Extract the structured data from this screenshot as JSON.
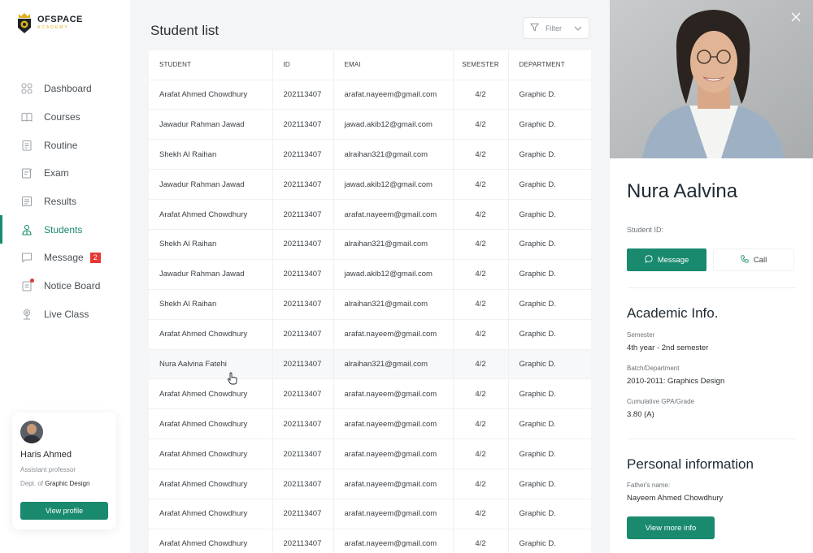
{
  "brand": {
    "name": "OFSPACE",
    "sub": "ACADEMY"
  },
  "nav": [
    {
      "label": "Dashboard",
      "icon": "dashboard-icon"
    },
    {
      "label": "Courses",
      "icon": "book-icon"
    },
    {
      "label": "Routine",
      "icon": "routine-icon"
    },
    {
      "label": "Exam",
      "icon": "exam-icon"
    },
    {
      "label": "Results",
      "icon": "results-icon"
    },
    {
      "label": "Students",
      "icon": "students-icon",
      "active": true
    },
    {
      "label": "Message",
      "icon": "message-icon",
      "badge": "2"
    },
    {
      "label": "Notice Board",
      "icon": "notice-icon",
      "dot": true
    },
    {
      "label": "Live Class",
      "icon": "live-class-icon"
    }
  ],
  "profile": {
    "name": "Haris Ahmed",
    "role": "Assistant professor",
    "dept_prefix": "Dept. of",
    "dept": "Graphic Design",
    "button": "View profile"
  },
  "main": {
    "title": "Student list",
    "filter_label": "Filter"
  },
  "table": {
    "headers": [
      "STUDENT",
      "ID",
      "EMAI",
      "SEMESTER",
      "DEPARTMENT"
    ],
    "rows": [
      [
        "Arafat Ahmed Chowdhury",
        "202113407",
        "arafat.nayeem@gmail.com",
        "4/2",
        "Graphic D."
      ],
      [
        "Jawadur Rahman Jawad",
        "202113407",
        "jawad.akib12@gmail.com",
        "4/2",
        "Graphic D."
      ],
      [
        "Shekh Al Raihan",
        "202113407",
        "alraihan321@gmail.com",
        "4/2",
        "Graphic D."
      ],
      [
        "Jawadur Rahman Jawad",
        "202113407",
        "jawad.akib12@gmail.com",
        "4/2",
        "Graphic D."
      ],
      [
        "Arafat Ahmed Chowdhury",
        "202113407",
        "arafat.nayeem@gmail.com",
        "4/2",
        "Graphic D."
      ],
      [
        "Shekh Al Raihan",
        "202113407",
        "alraihan321@gmail.com",
        "4/2",
        "Graphic D."
      ],
      [
        "Jawadur Rahman Jawad",
        "202113407",
        "jawad.akib12@gmail.com",
        "4/2",
        "Graphic D."
      ],
      [
        "Shekh Al Raihan",
        "202113407",
        "alraihan321@gmail.com",
        "4/2",
        "Graphic D."
      ],
      [
        "Arafat Ahmed Chowdhury",
        "202113407",
        "arafat.nayeem@gmail.com",
        "4/2",
        "Graphic D."
      ],
      [
        "Nura Aalvina Fatehi",
        "202113407",
        "alraihan321@gmail.com",
        "4/2",
        "Graphic D."
      ],
      [
        "Arafat Ahmed Chowdhury",
        "202113407",
        "arafat.nayeem@gmail.com",
        "4/2",
        "Graphic D."
      ],
      [
        "Arafat Ahmed Chowdhury",
        "202113407",
        "arafat.nayeem@gmail.com",
        "4/2",
        "Graphic D."
      ],
      [
        "Arafat Ahmed Chowdhury",
        "202113407",
        "arafat.nayeem@gmail.com",
        "4/2",
        "Graphic D."
      ],
      [
        "Arafat Ahmed Chowdhury",
        "202113407",
        "arafat.nayeem@gmail.com",
        "4/2",
        "Graphic D."
      ],
      [
        "Arafat Ahmed Chowdhury",
        "202113407",
        "arafat.nayeem@gmail.com",
        "4/2",
        "Graphic D."
      ],
      [
        "Arafat Ahmed Chowdhury",
        "202113407",
        "arafat.nayeem@gmail.com",
        "4/2",
        "Graphic D."
      ]
    ],
    "highlighted_row": 9
  },
  "detail": {
    "name": "Nura Aalvina",
    "student_id_label": "Student ID:",
    "message_button": "Message",
    "call_button": "Call",
    "academic_title": "Academic Info.",
    "semester_label": "Semester",
    "semester_value": "4th year - 2nd semester",
    "batch_label": "Batch/Department",
    "batch_value": "2010-2011: Graphics Design",
    "gpa_label": "Cumulative GPA/Grade",
    "gpa_value": "3.80 (A)",
    "personal_title": "Personal information",
    "father_label": "Father's name:",
    "father_value": "Nayeem Ahmed Chowdhury",
    "more_button": "View more info"
  },
  "colors": {
    "accent": "#1a8a6e",
    "badge": "#e53935",
    "logo_gold": "#e1b11c"
  }
}
